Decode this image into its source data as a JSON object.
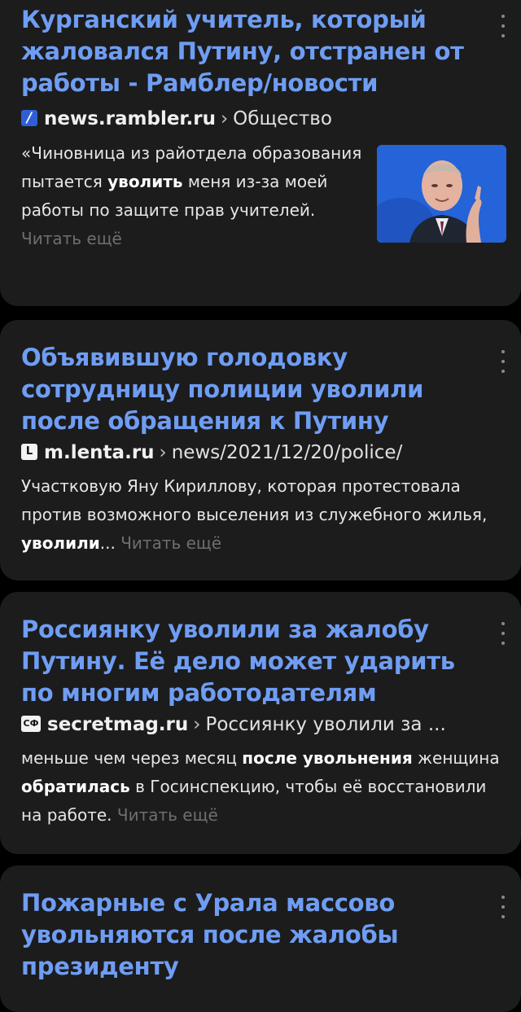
{
  "results": [
    {
      "title": "Курганский учитель, который жаловался Путину, отстранен от работы - Рамблер/новости",
      "favicon_icon": "rambler-favicon-icon",
      "domain": "news.rambler.ru",
      "separator": "›",
      "path": "Общество",
      "snippet_parts": [
        "«Чиновница из райотдела образования пытается ",
        "уволить",
        " меня из-за моей работы по защите прав учителей."
      ],
      "read_more": "Читать ещё"
    },
    {
      "title": "Объявившую голодовку сотрудницу полиции уволили после обращения к Путину",
      "favicon_icon": "lenta-favicon-icon",
      "favicon_text": "L",
      "domain": "m.lenta.ru",
      "separator": "›",
      "path": "news/2021/12/20/police/",
      "snippet_parts": [
        "Участковую Яну Кириллову, которая протестовала против возможного выселения из служебного жилья, ",
        "уволили",
        "..."
      ],
      "read_more": "Читать ещё"
    },
    {
      "title": "Россиянку уволили за жалобу Путину. Её дело может ударить по многим работодателям",
      "favicon_icon": "secretmag-favicon-icon",
      "favicon_text": "СФ",
      "domain": "secretmag.ru",
      "separator": "›",
      "path": "Россиянку уволили за ...",
      "snippet_parts": [
        "меньше чем через месяц ",
        "после увольнения",
        " женщина ",
        "обратилась",
        " в Госинспекцию, чтобы её восстановили на работе."
      ],
      "read_more": "Читать ещё"
    },
    {
      "title": "Пожарные с Урала массово увольняются после жалобы президенту"
    }
  ],
  "colors": {
    "background": "#000000",
    "card": "#1c1c1c",
    "title_link": "#6f9df3",
    "read_more": "#6e6e6e"
  }
}
